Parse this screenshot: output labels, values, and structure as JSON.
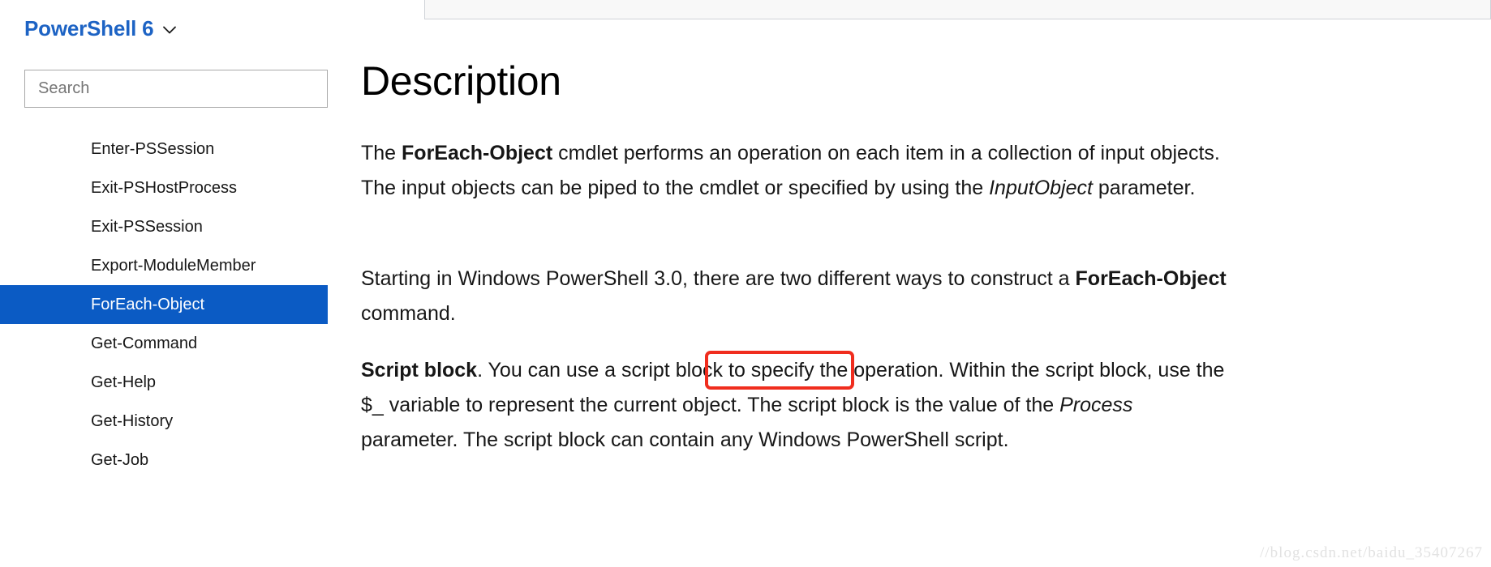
{
  "sidebar": {
    "version_switcher": {
      "label": "PowerShell 6",
      "chevron_icon": "chevron-down-icon",
      "color": "#1d63c4"
    },
    "search": {
      "icon": "search-icon",
      "placeholder": "Search",
      "value": ""
    },
    "nav_items": [
      {
        "label": "Enter-PSSession",
        "selected": false
      },
      {
        "label": "Exit-PSHostProcess",
        "selected": false
      },
      {
        "label": "Exit-PSSession",
        "selected": false
      },
      {
        "label": "Export-ModuleMember",
        "selected": false
      },
      {
        "label": "ForEach-Object",
        "selected": true
      },
      {
        "label": "Get-Command",
        "selected": false
      },
      {
        "label": "Get-Help",
        "selected": false
      },
      {
        "label": "Get-History",
        "selected": false
      },
      {
        "label": "Get-Job",
        "selected": false
      }
    ],
    "selected_color": "#0b5bc4"
  },
  "main": {
    "title": "Description",
    "paragraphs": {
      "p1": {
        "seg1": "The ",
        "bold1": "ForEach-Object",
        "seg2": " cmdlet performs an operation on each item in a collection of input objects. The input objects can be piped to the cmdlet or specified by using the ",
        "italic1": "InputObject",
        "seg3": " parameter."
      },
      "p2": {
        "seg1": "Starting in Windows PowerShell 3.0, there are two different ways to construct a ",
        "bold1": "ForEach-Object",
        "seg2": " command."
      },
      "p3": {
        "bold1": "Script block",
        "seg1": ". You can use a script block to specify the operation. Within the script block, use the $_ variable to represent the current object. The script block is the value of the ",
        "italic1": "Process",
        "seg2": " parameter. The script block can contain any Windows PowerShell script."
      }
    },
    "annotation": {
      "target_text": "Script block.",
      "color": "#f02d1e"
    }
  },
  "watermark": {
    "text": "//blog.csdn.net/baidu_35407267"
  }
}
